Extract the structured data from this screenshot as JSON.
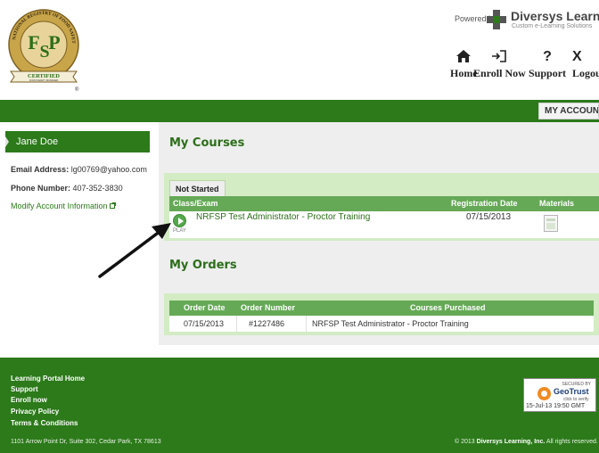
{
  "header": {
    "logo": {
      "ring_text": "NATIONAL REGISTRY OF FOOD SAFETY PROFESSIONALS",
      "monogram_f": "F",
      "monogram_s": "S",
      "monogram_p": "P",
      "banner": "CERTIFIED",
      "banner_sub": "FOOD SAFETY MANAGER",
      "registered": "®"
    },
    "powered_by": "Powered by",
    "brand_name": "Diversys Learning",
    "brand_sub": "Custom e-Learning Solutions",
    "nav": [
      {
        "label": "Home",
        "icon": "home-icon"
      },
      {
        "label": "Enroll Now",
        "icon": "enroll-icon"
      },
      {
        "label": "Support",
        "icon": "question-icon"
      },
      {
        "label": "Logout",
        "icon": "close-icon"
      }
    ]
  },
  "topbar": {
    "my_account": "MY ACCOUNT"
  },
  "sidebar": {
    "user_name": "Jane Doe",
    "email_label": "Email Address:",
    "email_value": "lg00769@yahoo.com",
    "phone_label": "Phone Number:",
    "phone_value": "407-352-3830",
    "modify_link": "Modify Account Information"
  },
  "courses": {
    "title": "My Courses",
    "tab": "Not Started",
    "columns": [
      "Class/Exam",
      "Registration Date",
      "Materials"
    ],
    "rows": [
      {
        "course": "NRFSP Test Administrator - Proctor Training",
        "registration_date": "07/15/2013",
        "play_label": "PLAY"
      }
    ]
  },
  "orders": {
    "title": "My Orders",
    "columns": [
      "Order Date",
      "Order Number",
      "Courses Purchased"
    ],
    "rows": [
      {
        "order_date": "07/15/2013",
        "order_number": "#1227486",
        "courses": "NRFSP Test Administrator - Proctor Training"
      }
    ]
  },
  "footer": {
    "links": [
      "Learning Portal Home",
      "Support",
      "Enroll now",
      "Privacy Policy",
      "Terms & Conditions"
    ],
    "address": "1101 Arrow Point Dr, Suite 302, Cedar Park, TX 78613",
    "copyright_prefix": "© 2013",
    "copyright_company": "Diversys Learning, Inc.",
    "copyright_suffix": "All rights reserved."
  },
  "geotrust": {
    "secured_by": "SECURED BY",
    "name": "GeoTrust",
    "click": "click to verify",
    "date": "15-Jul-13 19:50 GMT"
  },
  "colors": {
    "brand_green": "#2c7a1a",
    "table_header_green": "#65a956",
    "panel_green": "#d3ecc4",
    "panel_gray": "#eeeeee"
  }
}
